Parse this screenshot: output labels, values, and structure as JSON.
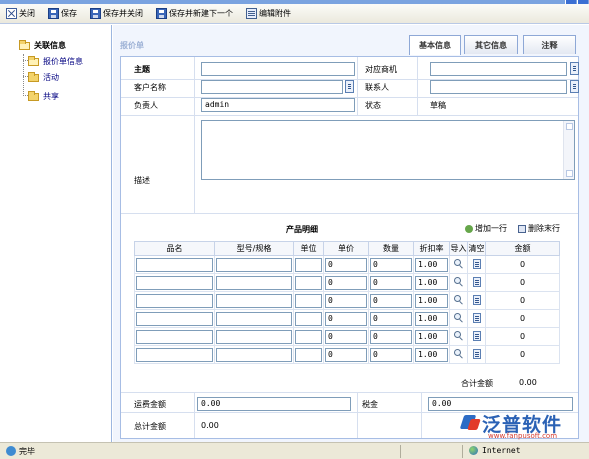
{
  "toolbar": {
    "close_label": "关闭",
    "save_label": "保存",
    "save_close_label": "保存并关闭",
    "save_new_label": "保存并新建下一个",
    "edit_attach_label": "编辑附件"
  },
  "sidebar": {
    "root_label": "关联信息",
    "items": [
      {
        "label": "报价单信息"
      },
      {
        "label": "活动"
      },
      {
        "label": "共享"
      }
    ]
  },
  "form": {
    "title": "报价单",
    "tabs": [
      {
        "label": "基本信息",
        "active": true
      },
      {
        "label": "其它信息",
        "active": false
      },
      {
        "label": "注释",
        "active": false
      }
    ],
    "fields": {
      "subject_label": "主题",
      "subject_value": "",
      "opportunity_label": "对应商机",
      "opportunity_value": "",
      "customer_label": "客户名称",
      "customer_value": "",
      "contact_label": "联系人",
      "contact_value": "",
      "owner_label": "负责人",
      "owner_value": "admin",
      "status_label": "状态",
      "status_value": "草稿",
      "description_label": "描述",
      "description_value": ""
    }
  },
  "products": {
    "section_title": "产品明细",
    "add_row_label": "增加一行",
    "delete_row_label": "删除末行",
    "columns": [
      "品名",
      "型号/规格",
      "单位",
      "单价",
      "数量",
      "折扣率",
      "导入",
      "清空",
      "金额"
    ],
    "rows": [
      {
        "name": "",
        "model": "",
        "unit": "",
        "price": "0",
        "qty": "0",
        "discount": "1.00",
        "amount": "0"
      },
      {
        "name": "",
        "model": "",
        "unit": "",
        "price": "0",
        "qty": "0",
        "discount": "1.00",
        "amount": "0"
      },
      {
        "name": "",
        "model": "",
        "unit": "",
        "price": "0",
        "qty": "0",
        "discount": "1.00",
        "amount": "0"
      },
      {
        "name": "",
        "model": "",
        "unit": "",
        "price": "0",
        "qty": "0",
        "discount": "1.00",
        "amount": "0"
      },
      {
        "name": "",
        "model": "",
        "unit": "",
        "price": "0",
        "qty": "0",
        "discount": "1.00",
        "amount": "0"
      },
      {
        "name": "",
        "model": "",
        "unit": "",
        "price": "0",
        "qty": "0",
        "discount": "1.00",
        "amount": "0"
      }
    ],
    "subtotal_label": "合计金额",
    "subtotal_value": "0.00"
  },
  "totals": {
    "freight_label": "运费金额",
    "freight_value": "0.00",
    "tax_label": "税金",
    "tax_value": "0.00",
    "total_label": "总计金额",
    "total_value": "0.00"
  },
  "status_bar": {
    "left_text": "完毕",
    "zone_text": "Internet"
  },
  "watermark": {
    "brand": "泛普软件",
    "url": "www.fanpusoft.com"
  },
  "colors": {
    "panel_border": "#a7bde4",
    "input_border": "#7f9db9",
    "nav_link": "#000080",
    "main_bg": "#f1f5fd"
  }
}
